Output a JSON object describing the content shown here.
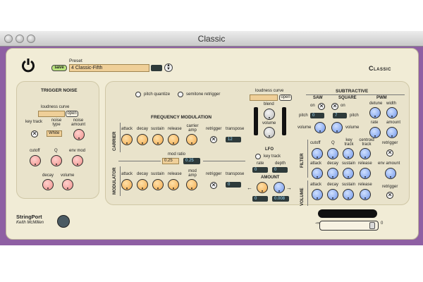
{
  "window": {
    "title": "Classic"
  },
  "header": {
    "preset_label": "Preset",
    "save_label": "save",
    "preset_name": "4 Classic-Fifth",
    "brand": "Classic"
  },
  "trigger_noise": {
    "title": "TRIGGER NOISE",
    "loudness_curve": "loudness curve",
    "open": "open",
    "key_track": "key track",
    "noise_type": "noise type",
    "noise_type_value": "White",
    "noise_amount": "noise amount",
    "cutoff": "cutoff",
    "q": "Q",
    "env_mod": "env mod",
    "decay": "decay",
    "volume": "volume"
  },
  "freq_mod": {
    "pitch_quantize": "pitch quantize",
    "semitone_retrigger": "semitone retrigger",
    "title": "FREQUENCY MODULATION",
    "carrier": "CARRIER",
    "modulator": "MODULATOR",
    "attack": "attack",
    "decay": "decay",
    "sustain": "sustain",
    "release": "release",
    "carrier_amp": "carrier amp",
    "mod_amp": "mod amp",
    "retrigger": "retrigger",
    "transpose": "transpose",
    "carrier_transpose": "12",
    "modulator_transpose": "0",
    "mod_ratio": "mod ratio",
    "mod_ratio_a": "0.25",
    "mod_ratio_b": "0.25"
  },
  "mix": {
    "loudness_curve": "loudness curve",
    "open": "open",
    "blend": "blend",
    "volume": "volume",
    "lfo": "LFO",
    "key_track": "key track",
    "rate": "rate",
    "depth": "depth",
    "rate_value": "0",
    "depth_value": "0",
    "amount": "AMOUNT",
    "amount_a": "0",
    "amount_b": "0.008"
  },
  "subtractive": {
    "title": "SUBTRACTIVE",
    "saw": "SAW",
    "square": "SQUARE",
    "pwm": "PWM",
    "on": "on",
    "pitch": "pitch",
    "saw_pitch": "0",
    "square_pitch": "7",
    "volume": "volume",
    "detune": "detune",
    "width": "width",
    "rate": "rate",
    "amount": "amount",
    "filter": "FILTER",
    "cutoff": "cutoff",
    "q": "Q",
    "key_track": "key track",
    "centroid_track": "centroid track",
    "retrigger": "retrigger",
    "attack": "attack",
    "decay": "decay",
    "sustain": "sustain",
    "release": "release",
    "env_amount": "env amount",
    "volume_label": "VOLUME"
  },
  "footer": {
    "logo_line1": "StringPort",
    "logo_line2": "Keith McMillen",
    "slider_min": "-∞",
    "slider_max": "0"
  },
  "colors": {
    "frame": "#8e5fa3",
    "panel": "#f1ecd6",
    "orange": "#f2a94a",
    "pink": "#ef8f8a",
    "blue": "#6f95e8"
  }
}
